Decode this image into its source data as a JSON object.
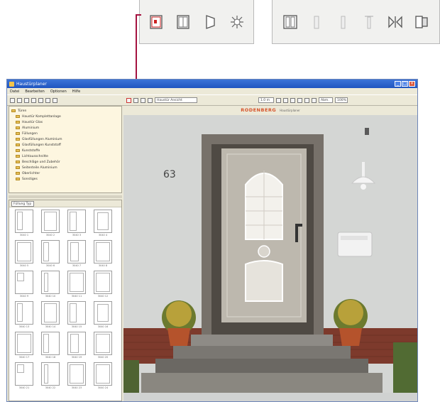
{
  "window": {
    "title": "Haustürplaner",
    "menu": [
      "Datei",
      "Bearbeiten",
      "Optionen",
      "Hilfe"
    ],
    "controls": [
      "minimize",
      "maximize",
      "close"
    ]
  },
  "callouts": {
    "left_icons": [
      "door-frame-icon",
      "door-panel-icon",
      "door-swing-icon",
      "light-burst-icon"
    ],
    "right_icons": [
      "double-frame-icon",
      "sidelight-icon",
      "narrow-panel-icon",
      "transom-icon",
      "mirror-icon",
      "door-view-icon"
    ]
  },
  "toolbar": {
    "view_select": "Haustür Ansicht",
    "size_field": "1.0 m",
    "unit_field": "Abm.",
    "zoom_field": "100%"
  },
  "tree": {
    "items": [
      "Türen",
      "Haustür Komplettanlage",
      "Haustür Glas",
      "Aluminium",
      "Füllungen",
      "Glasfüllungen Aluminium",
      "Glasfüllungen Kunststoff",
      "Kunststoffe",
      "Lichtausschnitte",
      "Beschläge und Zubehör",
      "Seitenteile Aluminium",
      "Oberlichter",
      "Sonstiges"
    ]
  },
  "gallery": {
    "filter": "Füllung Typ",
    "tiles": [
      "3040 1",
      "3040 2",
      "3040 3",
      "3040 4",
      "3040 5",
      "3040 6",
      "3040 7",
      "3040 8",
      "3040 9",
      "3040 10",
      "3040 11",
      "3040 12",
      "3040 13",
      "3040 14",
      "3040 15",
      "3040 16",
      "3040 17",
      "3040 18",
      "3040 19",
      "3040 20",
      "3040 21",
      "3040 22",
      "3040 23",
      "3040 24"
    ]
  },
  "header": {
    "logo": "RODENBERG",
    "logo_sub": "Haustürplaner"
  },
  "colors": {
    "accent_line": "#a4123f",
    "title_bar": "#1f55c0",
    "logo": "#d6532a",
    "door": "#bdb8ae",
    "wall": "#d7d9d8"
  }
}
